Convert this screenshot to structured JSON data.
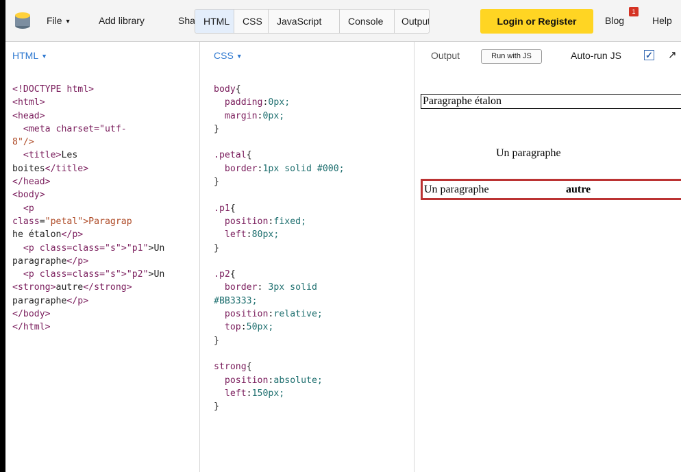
{
  "topbar": {
    "logo": "database-icon",
    "file_label": "File",
    "add_library_label": "Add library",
    "share_label": "Share",
    "tabs": [
      "HTML",
      "CSS",
      "JavaScript",
      "Console",
      "Output"
    ],
    "login_label": "Login or Register",
    "blog_label": "Blog",
    "blog_badge": "1",
    "help_label": "Help"
  },
  "html_panel": {
    "title": "HTML",
    "lines": [
      "<!DOCTYPE html>",
      "<html>",
      "<head>",
      "  <meta charset=\"utf-",
      "8\"/>",
      "  <title>Les",
      "boites</title>",
      "</head>",
      "<body>",
      "  <p",
      "class=\"petal\">Paragrap",
      "he étalon</p>",
      "  <p class=\"p1\">Un",
      "paragraphe</p>",
      "  <p class=\"p2\">Un",
      "<strong>autre</strong>",
      "paragraphe</p>",
      "</body>",
      "</html>"
    ]
  },
  "css_panel": {
    "title": "CSS",
    "lines": [
      "body{",
      "  padding:0px;",
      "  margin:0px;",
      "}",
      "",
      ".petal{",
      "  border:1px solid #000;",
      "}",
      "",
      ".p1{",
      "  position:fixed;",
      "  left:80px;",
      "}",
      "",
      ".p2{",
      "  border: 3px solid",
      "#BB3333;",
      "  position:relative;",
      "  top:50px;",
      "}",
      "",
      "strong{",
      "  position:absolute;",
      "  left:150px;",
      "}"
    ]
  },
  "output_panel": {
    "title": "Output",
    "run_label": "Run with JS",
    "autorun_label": "Auto-run JS",
    "autorun_checked": "✓",
    "expand_icon": "↗",
    "p_etalon": "Paragraphe étalon",
    "p1": "Un paragraphe",
    "p2_prefix": "Un paragraphe",
    "p2_strong": "autre"
  },
  "colors": {
    "accent": "#2f79d0",
    "login": "#ffd523",
    "p2_border": "#BB3333"
  }
}
